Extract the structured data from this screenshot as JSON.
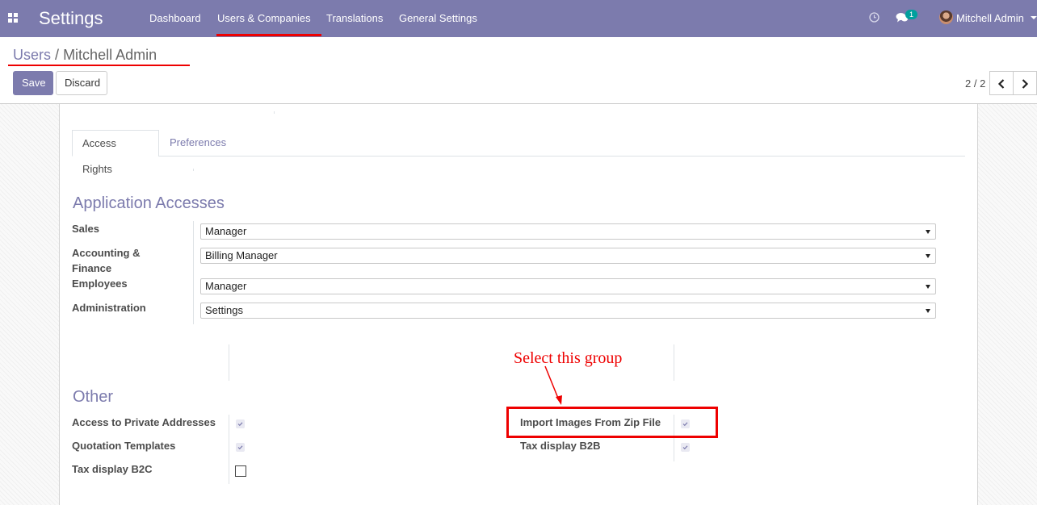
{
  "navbar": {
    "app_title": "Settings",
    "apps_icon": "grid-icon",
    "menu": [
      {
        "label": "Dashboard"
      },
      {
        "label": "Users & Companies"
      },
      {
        "label": "Translations"
      },
      {
        "label": "General Settings"
      }
    ],
    "active_menu": "Users & Companies",
    "activity_icon": "clock-icon",
    "messages_icon": "chat-icon",
    "messages_badge": "1",
    "user_name": "Mitchell Admin",
    "accent_color": "#7c7bad"
  },
  "control_panel": {
    "breadcrumb_parent": "Users",
    "breadcrumb_separator": "/",
    "breadcrumb_current": "Mitchell Admin",
    "save_label": "Save",
    "discard_label": "Discard",
    "pager_value": "2 / 2"
  },
  "tabs": [
    {
      "label": "Access Rights",
      "active": true
    },
    {
      "label": "Preferences",
      "active": false
    }
  ],
  "application_accesses": {
    "title": "Application Accesses",
    "fields": [
      {
        "label": "Sales",
        "value": "Manager"
      },
      {
        "label": "Accounting & Finance",
        "value": "Billing Manager"
      },
      {
        "label": "Employees",
        "value": "Manager"
      },
      {
        "label": "Administration",
        "value": "Settings"
      }
    ]
  },
  "other": {
    "title": "Other",
    "left": [
      {
        "label": "Access to Private Addresses",
        "checked": true
      },
      {
        "label": "Quotation Templates",
        "checked": true
      },
      {
        "label": "Tax display B2C",
        "checked": false
      }
    ],
    "right": [
      {
        "label": "Import Images From Zip File",
        "checked": true
      },
      {
        "label": "Tax display B2B",
        "checked": true
      }
    ]
  },
  "annotation": {
    "text": "Select this group",
    "color": "#e00000"
  }
}
